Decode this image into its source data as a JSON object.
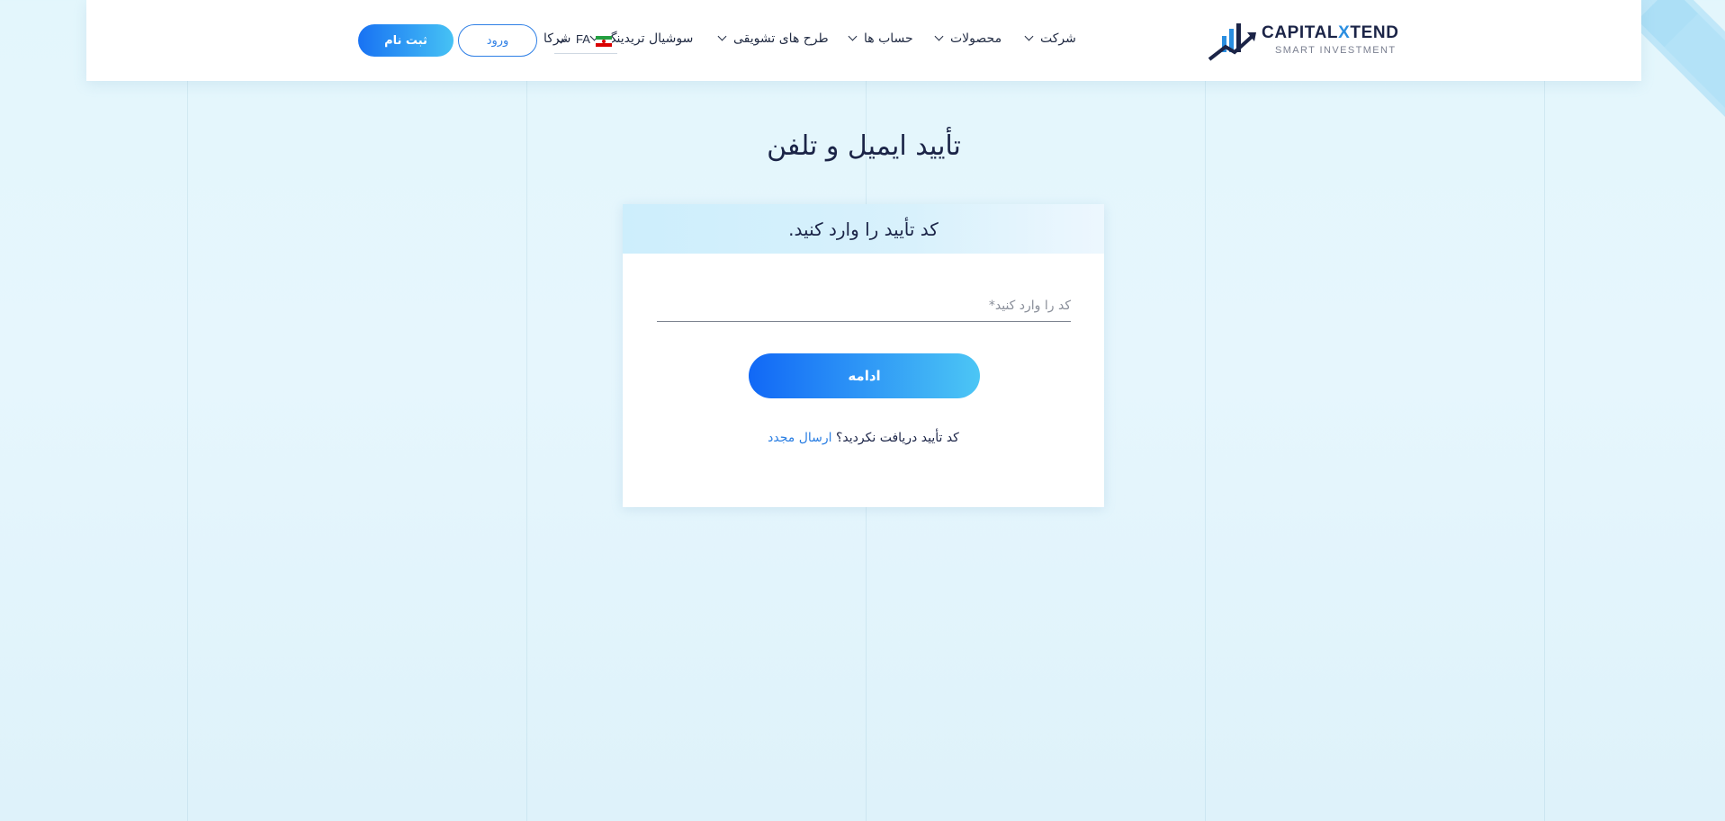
{
  "brand": {
    "name_part1": "CAPITAL",
    "name_x": "X",
    "name_part2": "TEND",
    "tagline": "SMART INVESTMENT"
  },
  "nav": {
    "items": [
      {
        "label": "شرکت",
        "has_dropdown": true
      },
      {
        "label": "محصولات",
        "has_dropdown": true
      },
      {
        "label": "حساب ها",
        "has_dropdown": true
      },
      {
        "label": "طرح های تشویقی",
        "has_dropdown": true
      },
      {
        "label": "سوشیال تریدینگ",
        "has_dropdown": true
      },
      {
        "label": "شرکا",
        "has_dropdown": false
      }
    ],
    "language": "FA",
    "login_label": "ورود",
    "register_label": "ثبت نام"
  },
  "page": {
    "title": "تأیید ایمیل و تلفن"
  },
  "verify_card": {
    "heading": "کد تأیید را وارد کنید.",
    "code_placeholder": "کد را وارد کنید*",
    "code_value": "",
    "continue_label": "ادامه",
    "resend_prompt": "کد تأیید دریافت نکردید؟",
    "resend_link": "ارسال مجدد"
  },
  "colors": {
    "primary_blue": "#1872f3",
    "accent_cyan": "#46c2f4",
    "text_dark": "#1b2447",
    "link_blue": "#2b7fe3"
  }
}
